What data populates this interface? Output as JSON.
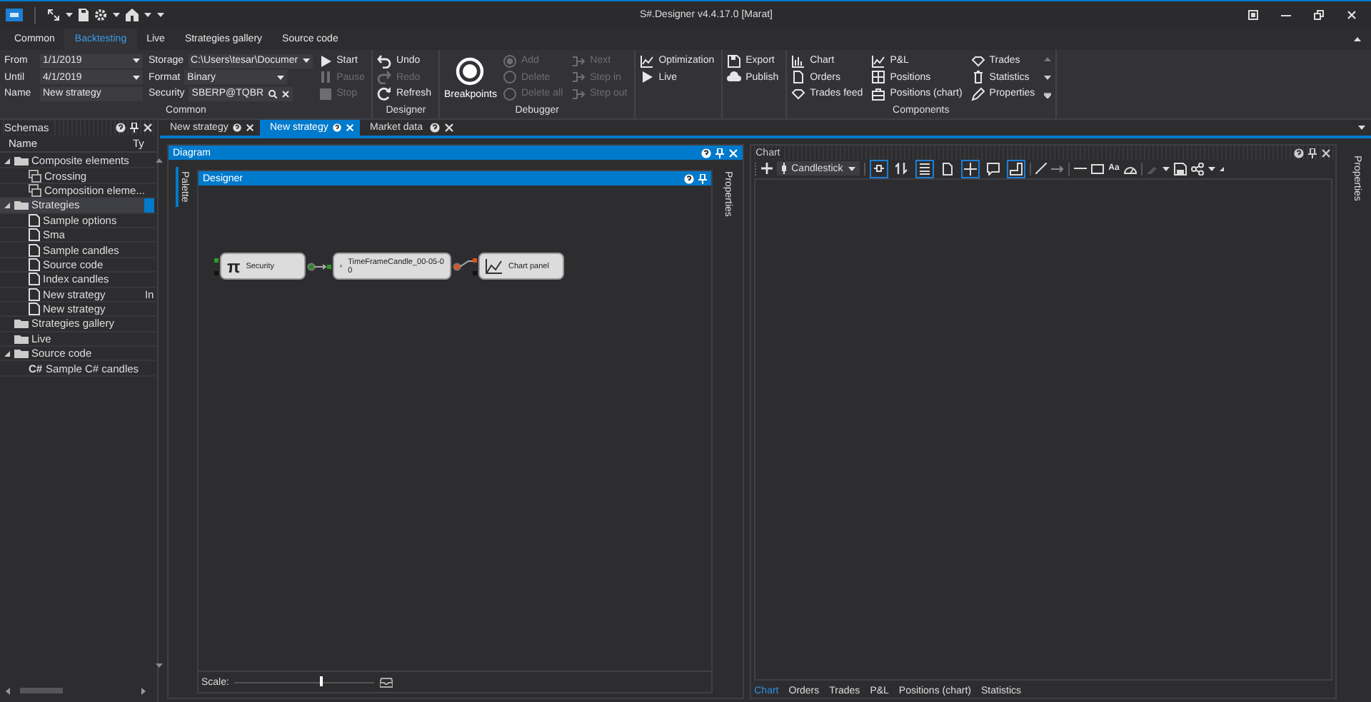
{
  "window": {
    "title": "S#.Designer v4.4.17.0 [Marat]"
  },
  "ribbon": {
    "tabs": [
      {
        "label": "Common",
        "selected": false
      },
      {
        "label": "Backtesting",
        "selected": true
      },
      {
        "label": "Live",
        "selected": false
      },
      {
        "label": "Strategies gallery",
        "selected": false
      },
      {
        "label": "Source code",
        "selected": false
      }
    ],
    "groups": [
      {
        "kind": "panel",
        "label": "Common",
        "columns": [
          [
            {
              "kind": "field",
              "label": "From",
              "value": "1/1/2019",
              "dropdown": true
            },
            {
              "kind": "field",
              "label": "Until",
              "value": "4/1/2019",
              "dropdown": true
            },
            {
              "kind": "field",
              "label": "Name",
              "value": "New strategy",
              "dropdown": false
            }
          ],
          [
            {
              "kind": "field",
              "label": "Storage",
              "value": "C:\\Users\\tesar\\Documer",
              "dropdown": true
            },
            {
              "kind": "field",
              "label": "Format",
              "value": "Binary",
              "dropdown": true
            },
            {
              "kind": "search",
              "label": "Security",
              "value": "SBERP@TQBR"
            }
          ],
          [
            {
              "kind": "button",
              "label": "Start",
              "disabled": false
            },
            {
              "kind": "button",
              "label": "Pause",
              "disabled": true
            },
            {
              "kind": "button",
              "label": "Stop",
              "disabled": true
            }
          ]
        ]
      },
      {
        "kind": "panel",
        "label": "Designer",
        "columns": [
          [
            {
              "kind": "button",
              "label": "Undo",
              "disabled": false
            },
            {
              "kind": "button",
              "label": "Redo",
              "disabled": true
            },
            {
              "kind": "button",
              "label": "Refresh",
              "disabled": false
            }
          ]
        ]
      },
      {
        "kind": "panel",
        "label": "Debugger",
        "columns": [
          [
            {
              "kind": "big",
              "label": "Breakpoints",
              "disabled": false
            }
          ],
          [
            {
              "kind": "button",
              "label": "Add",
              "disabled": true
            },
            {
              "kind": "button",
              "label": "Delete",
              "disabled": true
            },
            {
              "kind": "button",
              "label": "Delete all",
              "disabled": true
            }
          ],
          [
            {
              "kind": "button",
              "label": "Next",
              "disabled": true
            },
            {
              "kind": "button",
              "label": "Step in",
              "disabled": true
            },
            {
              "kind": "button",
              "label": "Step out",
              "disabled": true
            }
          ]
        ]
      },
      {
        "kind": "panel",
        "columns": [
          [
            {
              "kind": "button",
              "label": "Optimization",
              "disabled": false
            },
            {
              "kind": "button",
              "label": "Live",
              "disabled": false
            }
          ]
        ]
      },
      {
        "kind": "panel",
        "columns": [
          [
            {
              "kind": "button",
              "label": "Export",
              "disabled": false
            },
            {
              "kind": "button",
              "label": "Publish",
              "disabled": false
            }
          ]
        ]
      },
      {
        "kind": "gallery",
        "label": "Components",
        "columns": [
          [
            {
              "kind": "button",
              "label": "Chart",
              "disabled": false
            },
            {
              "kind": "button",
              "label": "Orders",
              "disabled": false
            },
            {
              "kind": "button",
              "label": "Trades feed",
              "disabled": false
            }
          ],
          [
            {
              "kind": "button",
              "label": "P&L",
              "disabled": false
            },
            {
              "kind": "button",
              "label": "Positions",
              "disabled": false
            },
            {
              "kind": "button",
              "label": "Positions (chart)",
              "disabled": false
            }
          ],
          [
            {
              "kind": "button",
              "label": "Trades",
              "disabled": false
            },
            {
              "kind": "button",
              "label": "Statistics",
              "disabled": false
            },
            {
              "kind": "button",
              "label": "Properties",
              "disabled": false
            }
          ]
        ]
      }
    ]
  },
  "schemas": {
    "title": "Schemas",
    "columns": [
      "Name",
      "Ty"
    ],
    "items": [
      {
        "label": "Composite elements",
        "expanded": true,
        "selected": false,
        "children": [
          {
            "label": "Crossing",
            "selected": false
          },
          {
            "label": "Composition eleme...",
            "selected": false
          }
        ]
      },
      {
        "label": "Strategies",
        "expanded": true,
        "selected": true,
        "children": [
          {
            "label": "Sample options",
            "selected": false
          },
          {
            "label": "Sma",
            "selected": false
          },
          {
            "label": "Sample candles",
            "selected": false
          },
          {
            "label": "Source code",
            "selected": false
          },
          {
            "label": "Index candles",
            "selected": false
          },
          {
            "label": "New strategy",
            "type": "In",
            "selected": false
          },
          {
            "label": "New strategy",
            "selected": false
          }
        ]
      },
      {
        "label": "Strategies gallery",
        "selected": false
      },
      {
        "label": "Live",
        "selected": false
      },
      {
        "label": "Source code",
        "expanded": true,
        "selected": false,
        "children": [
          {
            "label": "Sample C# candles",
            "badge": "C#",
            "selected": false
          }
        ]
      }
    ]
  },
  "documents": {
    "tabs": [
      {
        "label": "New strategy",
        "selected": false
      },
      {
        "label": "New strategy",
        "selected": true
      },
      {
        "label": "Market data",
        "selected": false
      }
    ]
  },
  "diagram": {
    "title": "Diagram",
    "left_tab": "Palette",
    "right_tab": "Properties",
    "designer_title": "Designer",
    "nodes": [
      {
        "symbol": "π",
        "lines": [
          "Security"
        ]
      },
      {
        "lines": [
          "TimeFrameCandle_00-05-0",
          "0"
        ]
      },
      {
        "lines": [
          "Chart panel"
        ]
      }
    ],
    "scale": {
      "label": "Scale:",
      "level": 0.62
    }
  },
  "chart": {
    "title": "Chart",
    "chart_type": "Candlestick",
    "toggles": [
      {
        "on": true
      },
      {
        "on": false
      },
      {
        "on": true
      },
      {
        "on": false
      },
      {
        "on": true
      },
      {
        "on": false
      },
      {
        "on": true
      }
    ],
    "text_tool": "Aa",
    "tabs": [
      {
        "label": "Chart",
        "selected": true
      },
      {
        "label": "Orders",
        "selected": false
      },
      {
        "label": "Trades",
        "selected": false
      },
      {
        "label": "P&L",
        "selected": false
      },
      {
        "label": "Positions (chart)",
        "selected": false
      },
      {
        "label": "Statistics",
        "selected": false
      }
    ]
  },
  "right_strip": {
    "tab": "Properties"
  }
}
